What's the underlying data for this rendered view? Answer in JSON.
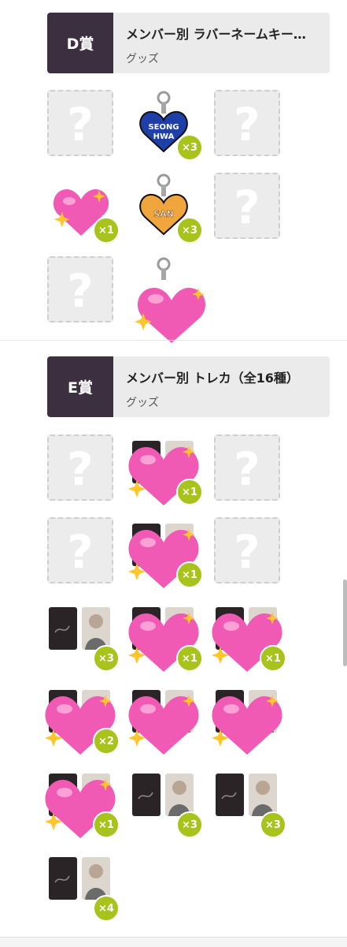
{
  "prize_d": {
    "rank": "D賞",
    "title": "メンバー別 ラバーネームキー…",
    "category": "グッズ",
    "items": [
      {
        "type": "unknown"
      },
      {
        "type": "keychain",
        "label_line1": "SEONG",
        "label_line2": "HWA",
        "count": "×3"
      },
      {
        "type": "unknown"
      },
      {
        "type": "hidden",
        "count": "×1"
      },
      {
        "type": "keychain",
        "label_line1": "SAN",
        "count": "×3"
      },
      {
        "type": "unknown"
      },
      {
        "type": "unknown"
      },
      {
        "type": "hidden",
        "count": ""
      }
    ]
  },
  "prize_e": {
    "rank": "E賞",
    "title": "メンバー別 トレカ（全16種）",
    "category": "グッズ",
    "items": [
      {
        "type": "unknown"
      },
      {
        "type": "hidden",
        "count": "×1"
      },
      {
        "type": "unknown"
      },
      {
        "type": "unknown"
      },
      {
        "type": "hidden",
        "count": "×1"
      },
      {
        "type": "unknown"
      },
      {
        "type": "card",
        "count": "×3"
      },
      {
        "type": "hidden",
        "count": "×1"
      },
      {
        "type": "hidden",
        "count": "×1"
      },
      {
        "type": "hidden",
        "count": "×2"
      },
      {
        "type": "hidden",
        "count": ""
      },
      {
        "type": "hidden",
        "count": ""
      },
      {
        "type": "hidden",
        "count": "×1"
      },
      {
        "type": "card",
        "count": "×3"
      },
      {
        "type": "card",
        "count": "×3"
      },
      {
        "type": "card",
        "count": "×4"
      }
    ]
  },
  "colors": {
    "rank_bg": "#3c3040",
    "header_bg": "#ebebec",
    "badge": "#a7c31c",
    "heart": "#f05ab4",
    "sparkle": "#ffc52a"
  }
}
